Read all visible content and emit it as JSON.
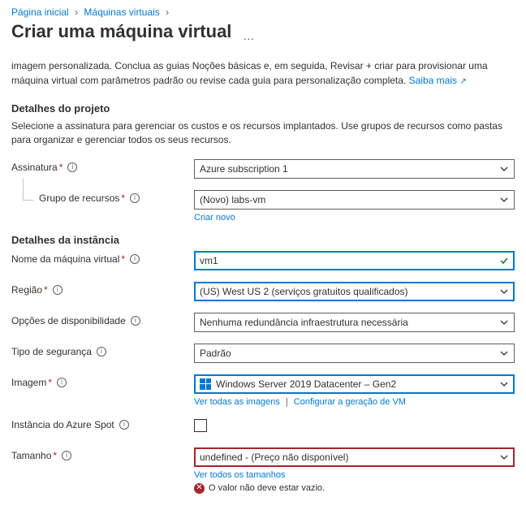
{
  "breadcrumb": {
    "home": "Página inicial",
    "vms": "Máquinas virtuais"
  },
  "page_title": "Criar uma máquina virtual",
  "intro": {
    "text": "imagem personalizada. Conclua as guias Noções básicas e, em seguida, Revisar + criar para provisionar uma máquina virtual com parâmetros padrão ou revise cada guia para personalização completa.",
    "learn_more": "Saiba mais"
  },
  "sections": {
    "project": {
      "title": "Detalhes do projeto",
      "desc": "Selecione a assinatura para gerenciar os custos e os recursos implantados. Use grupos de recursos como pastas para organizar e gerenciar todos os seus recursos.",
      "subscription_label": "Assinatura",
      "subscription_value": "Azure subscription 1",
      "rg_label": "Grupo de recursos",
      "rg_value": "(Novo) labs-vm",
      "rg_create_new": "Criar novo"
    },
    "instance": {
      "title": "Detalhes da instância",
      "vmname_label": "Nome da máquina virtual",
      "vmname_value": "vm1",
      "region_label": "Região",
      "region_value": "(US) West US 2 (serviços gratuitos qualificados)",
      "availability_label": "Opções de disponibilidade",
      "availability_value": "Nenhuma redundância infraestrutura necessária",
      "security_label": "Tipo de segurança",
      "security_value": "Padrão",
      "image_label": "Imagem",
      "image_value": "Windows Server 2019 Datacenter – Gen2",
      "image_all": "Ver todas as imagens",
      "image_config_gen": "Configurar a geração de VM",
      "spot_label": "Instância do Azure Spot",
      "size_label": "Tamanho",
      "size_value": "undefined - (Preço não disponível)",
      "size_all": "Ver todos os tamanhos",
      "size_error": "O valor não deve estar vazio."
    }
  }
}
